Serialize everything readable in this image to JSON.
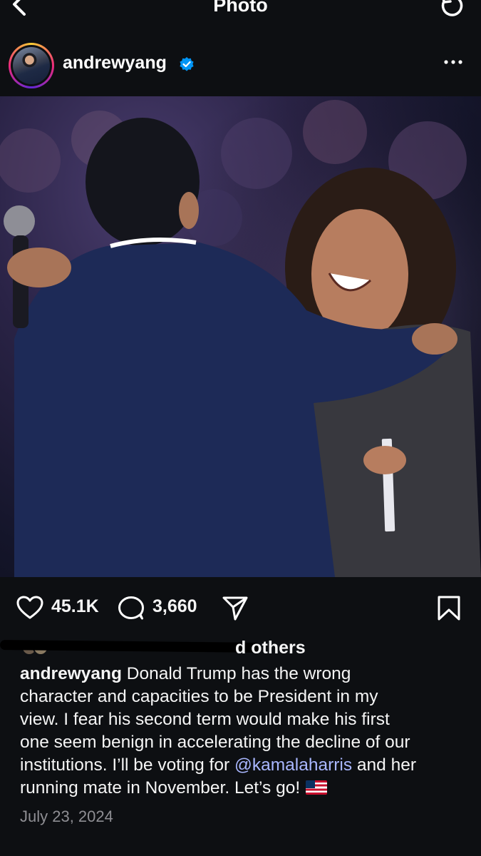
{
  "topbar": {
    "title": "Photo"
  },
  "post": {
    "username": "andrewyang",
    "verified": true,
    "likes": "45.1K",
    "comments": "3,660",
    "liked_by_suffix": "d others",
    "caption_user": "andrewyang",
    "caption_line1": "Donald Trump has the wrong",
    "caption_line2": "character and capacities to be President in my",
    "caption_line3": "view. I fear his second term would make his first",
    "caption_line4": "one seem benign in accelerating the decline of our",
    "caption_line5_pre": "institutions. I’ll be voting for",
    "caption_mention": "@kamalaharris",
    "caption_line5_post": "and her",
    "caption_line6": "running mate in November. Let’s go!",
    "date": "July 23, 2024"
  },
  "colors": {
    "background": "#0d0f12",
    "verified": "#0095f6",
    "mention": "#a9b7ff",
    "date": "#8e8e93"
  },
  "icons": [
    "back-arrow-icon",
    "refresh-icon",
    "verified-badge-icon",
    "more-icon",
    "heart-icon",
    "comment-icon",
    "share-icon",
    "bookmark-icon",
    "us-flag-icon"
  ]
}
